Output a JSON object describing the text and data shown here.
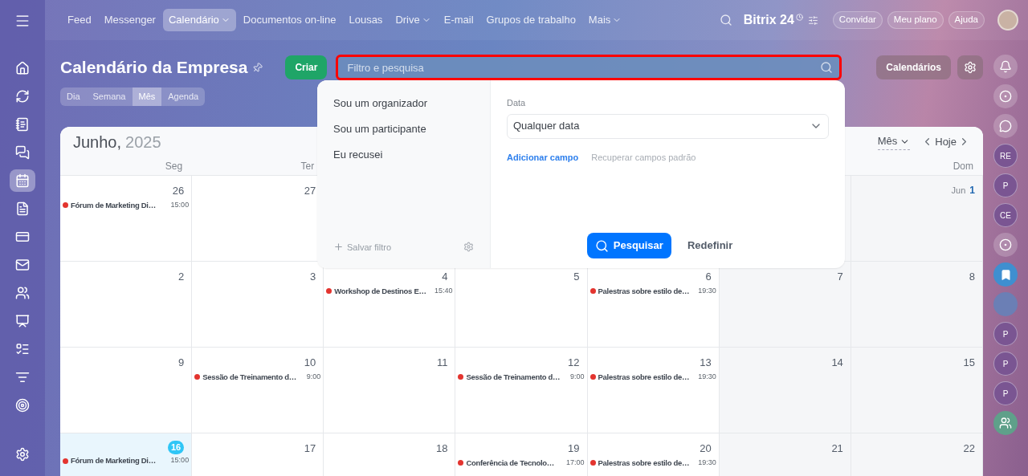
{
  "top_nav": {
    "items": [
      {
        "label": "Feed",
        "selected": false,
        "dropdown": false
      },
      {
        "label": "Messenger",
        "selected": false,
        "dropdown": false
      },
      {
        "label": "Calendário",
        "selected": true,
        "dropdown": true
      },
      {
        "label": "Documentos on-line",
        "selected": false,
        "dropdown": false
      },
      {
        "label": "Lousas",
        "selected": false,
        "dropdown": false
      },
      {
        "label": "Drive",
        "selected": false,
        "dropdown": true
      },
      {
        "label": "E-mail",
        "selected": false,
        "dropdown": false
      },
      {
        "label": "Grupos de trabalho",
        "selected": false,
        "dropdown": false
      },
      {
        "label": "Mais",
        "selected": false,
        "dropdown": true
      }
    ],
    "logo": {
      "name": "Bitrix",
      "number": "24"
    },
    "buttons": [
      "Convidar",
      "Meu plano",
      "Ajuda"
    ]
  },
  "left_sidebar": {
    "items": [
      {
        "selected": false
      },
      {
        "selected": false
      },
      {
        "selected": false
      },
      {
        "selected": false
      },
      {
        "selected": true
      },
      {
        "selected": false
      },
      {
        "selected": false
      },
      {
        "selected": false
      },
      {
        "selected": false
      },
      {
        "selected": false
      },
      {
        "selected": false
      },
      {
        "selected": false
      },
      {
        "selected": false
      }
    ]
  },
  "header": {
    "title": "Calendário da Empresa",
    "create_button": "Criar",
    "search": {
      "placeholder": "Filtro e pesquisa",
      "highlighted": true
    },
    "calendars_button": "Calendários"
  },
  "view_tabs": [
    {
      "label": "Dia",
      "selected": false
    },
    {
      "label": "Semana",
      "selected": false
    },
    {
      "label": "Mês",
      "selected": true
    },
    {
      "label": "Agenda",
      "selected": false
    }
  ],
  "calendar": {
    "month": "Junho,",
    "year": "2025",
    "view_select": "Mês",
    "today_button": "Hoje",
    "weekdays": [
      "Seg",
      "Ter",
      "Dom"
    ],
    "weeks": [
      {
        "days": [
          {
            "number": "26",
            "events": [
              {
                "title": "Fórum de Marketing Di…",
                "time": "15:00",
                "color": "#e3342f"
              }
            ]
          },
          {
            "number": "27"
          },
          {
            "month": "Jun",
            "number": "1"
          }
        ]
      },
      {
        "days": [
          {
            "number": "2"
          },
          {
            "number": "3"
          },
          {
            "number": "4",
            "events": [
              {
                "title": "Workshop de Destinos E…",
                "time": "15:40",
                "color": "#e3342f"
              }
            ]
          },
          {
            "number": "5"
          },
          {
            "number": "6",
            "events": [
              {
                "title": "Palestras sobre estilo de…",
                "time": "19:30",
                "color": "#e3342f"
              }
            ]
          },
          {
            "number": "7"
          },
          {
            "number": "8"
          }
        ]
      },
      {
        "days": [
          {
            "number": "9"
          },
          {
            "number": "10",
            "events": [
              {
                "title": "Sessão de Treinamento d…",
                "time": "9:00",
                "color": "#e3342f"
              }
            ]
          },
          {
            "number": "11"
          },
          {
            "number": "12",
            "events": [
              {
                "title": "Sessão de Treinamento d…",
                "time": "9:00",
                "color": "#e3342f"
              }
            ]
          },
          {
            "number": "13",
            "events": [
              {
                "title": "Palestras sobre estilo de…",
                "time": "19:30",
                "color": "#e3342f"
              }
            ]
          },
          {
            "number": "14"
          },
          {
            "number": "15"
          }
        ]
      },
      {
        "days": [
          {
            "number": "16",
            "today": true,
            "events": [
              {
                "title": "Fórum de Marketing Di…",
                "time": "15:00",
                "color": "#e3342f"
              }
            ]
          },
          {
            "number": "17",
            "today": false
          },
          {
            "number": "18"
          },
          {
            "number": "19",
            "events": [
              {
                "title": "Conferência de Tecnolo…",
                "time": "17:00",
                "color": "#e3342f"
              }
            ]
          },
          {
            "number": "20",
            "events": [
              {
                "title": "Palestras sobre estilo de…",
                "time": "19:30",
                "color": "#e3342f"
              }
            ]
          },
          {
            "number": "21"
          },
          {
            "number": "22"
          }
        ]
      }
    ]
  },
  "filter_popup": {
    "presets": [
      "Sou um organizador",
      "Sou um participante",
      "Eu recusei"
    ],
    "save_filter": "Salvar filtro",
    "field_label": "Data",
    "field_value": "Qualquer data",
    "add_field": "Adicionar campo",
    "restore_fields": "Recuperar campos padrão",
    "search_button": "Pesquisar",
    "reset_button": "Redefinir"
  },
  "right_bar": [
    {
      "kind": "bell"
    },
    {
      "kind": "icon"
    },
    {
      "kind": "chat"
    },
    {
      "kind": "letters",
      "text": "RE"
    },
    {
      "kind": "letters",
      "text": "P"
    },
    {
      "kind": "letters",
      "text": "CE"
    },
    {
      "kind": "icon"
    },
    {
      "kind": "bookmark"
    },
    {
      "kind": "photo"
    },
    {
      "kind": "letters",
      "text": "P"
    },
    {
      "kind": "letters",
      "text": "P"
    },
    {
      "kind": "letters",
      "text": "P"
    },
    {
      "kind": "group"
    }
  ]
}
